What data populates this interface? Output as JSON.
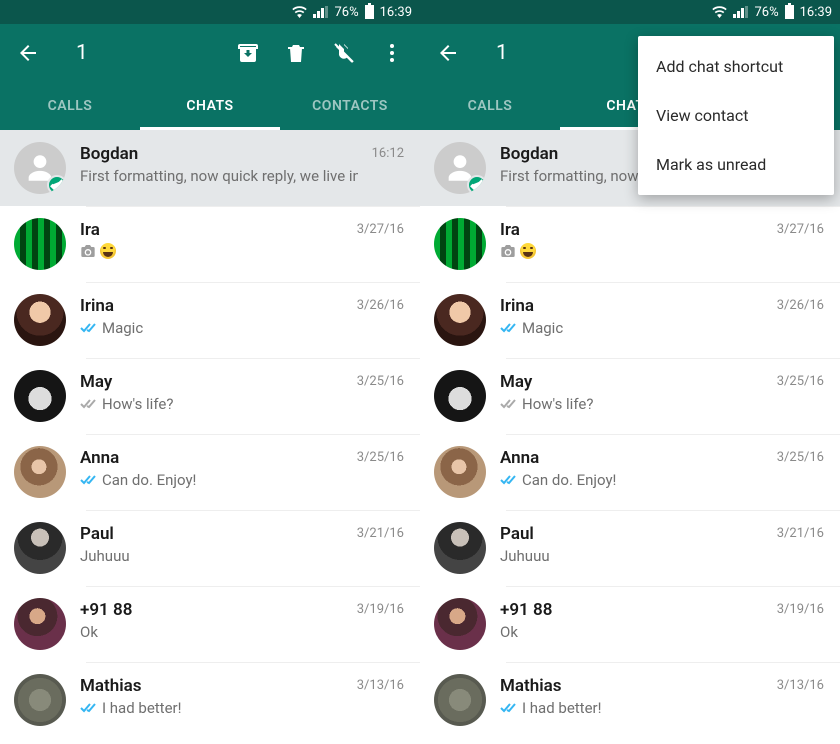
{
  "status": {
    "battery_pct": "76%",
    "time": "16:39"
  },
  "toolbar": {
    "selected_count": "1"
  },
  "tabs": {
    "calls": "CALLS",
    "chats": "CHATS",
    "contacts": "CONTACTS"
  },
  "menu": {
    "shortcut": "Add chat shortcut",
    "view": "View contact",
    "unread": "Mark as unread"
  },
  "chats": [
    {
      "name": "Bogdan",
      "msg": "First formatting, now quick reply, we live in t…",
      "time": "16:12",
      "avatar": "def",
      "selected": true
    },
    {
      "name": "Ira",
      "msg": "",
      "time": "3/27/16",
      "avatar": "p-ira",
      "cam": true,
      "emoji": true
    },
    {
      "name": "Irina",
      "msg": "Magic",
      "time": "3/26/16",
      "avatar": "p-irina",
      "ticks": "blue"
    },
    {
      "name": "May",
      "msg": "How's life?",
      "time": "3/25/16",
      "avatar": "p-may",
      "ticks": "gray"
    },
    {
      "name": "Anna",
      "msg": "Can do. Enjoy!",
      "time": "3/25/16",
      "avatar": "p-anna",
      "ticks": "blue"
    },
    {
      "name": "Paul",
      "msg": "Juhuuu",
      "time": "3/21/16",
      "avatar": "p-paul"
    },
    {
      "name": "+91 88",
      "msg": "Ok",
      "time": "3/19/16",
      "avatar": "p-num"
    },
    {
      "name": "Mathias",
      "msg": "I had better!",
      "time": "3/13/16",
      "avatar": "p-mathias",
      "ticks": "blue"
    }
  ]
}
